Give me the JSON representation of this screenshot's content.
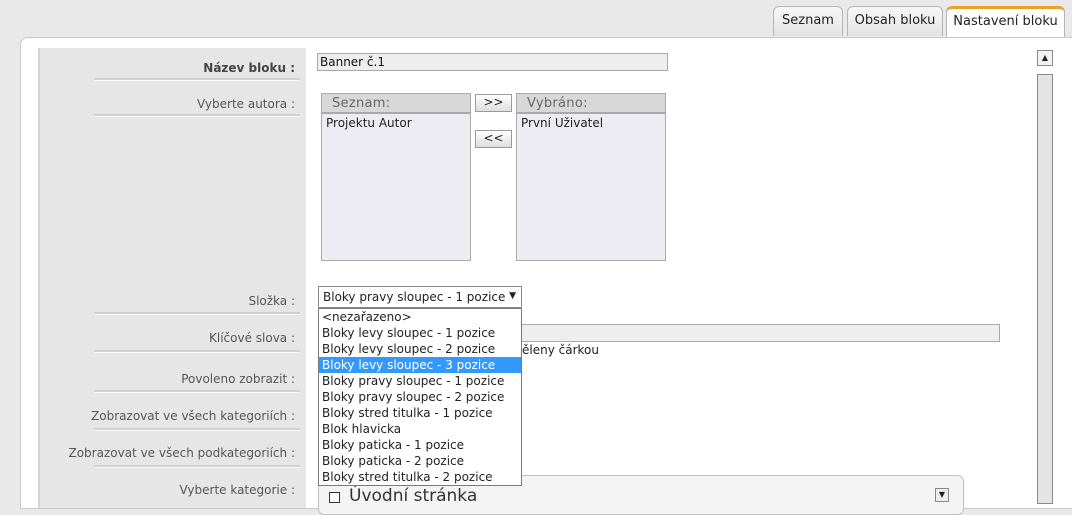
{
  "tabs": [
    "Seznam",
    "Obsah bloku",
    "Nastavení bloku"
  ],
  "active_tab": "Nastavení bloku",
  "form": {
    "nazev_label": "Název bloku :",
    "nazev_value": "Banner č.1",
    "autor_label": "Vyberte autora :",
    "seznam_header": "Seznam:",
    "vybrano_header": "Vybráno:",
    "seznam_items": [
      "Projektu Autor"
    ],
    "vybrano_items": [
      "První Uživatel"
    ],
    "add_button": ">>",
    "remove_button": "<<",
    "slozka_label": "Složka :",
    "slozka_value": "Bloky pravy sloupec - 1 pozice",
    "klicova_label": "Klíčové slova :",
    "klicova_hint": "ěleny čárkou",
    "povoleno_label": "Povoleno zobrazit :",
    "vsech_kat_label": "Zobrazovat ve všech kategoriích :",
    "vsech_podkat_label": "Zobrazovat ve všech podkategoriích :",
    "vyberte_kat_label": "Vyberte kategorie :",
    "kategorie_first": "Úvodní stránka"
  },
  "dropdown": {
    "options": [
      "<nezařazeno>",
      "Bloky levy sloupec - 1 pozice",
      "Bloky levy sloupec - 2 pozice",
      "Bloky levy sloupec - 3 pozice",
      "Bloky pravy sloupec - 1 pozice",
      "Bloky pravy sloupec - 2 pozice",
      "Bloky stred titulka - 1 pozice",
      "Blok hlavicka",
      "Bloky paticka - 1 pozice",
      "Bloky paticka - 2 pozice",
      "Bloky stred titulka - 2 pozice"
    ],
    "highlighted": "Bloky levy sloupec - 3 pozice"
  },
  "colors": {
    "tab_accent": "#f0a020",
    "highlight": "#3399ff"
  }
}
